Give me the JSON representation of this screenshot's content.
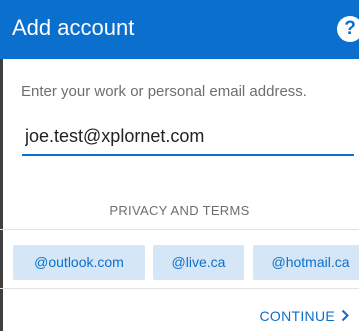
{
  "header": {
    "title": "Add account",
    "help_icon": "?"
  },
  "form": {
    "prompt": "Enter your work or personal email address.",
    "email_value": "joe.test@xplornet.com"
  },
  "privacy": {
    "label": "PRIVACY AND TERMS"
  },
  "domains": [
    {
      "label": "@outlook.com"
    },
    {
      "label": "@live.ca"
    },
    {
      "label": "@hotmail.ca"
    }
  ],
  "footer": {
    "continue_label": "CONTINUE"
  },
  "colors": {
    "accent": "#0b6fce",
    "chip_background": "#d5e7f7"
  },
  "icons": {
    "help": "question-mark-circle",
    "continue": "chevron-right"
  }
}
